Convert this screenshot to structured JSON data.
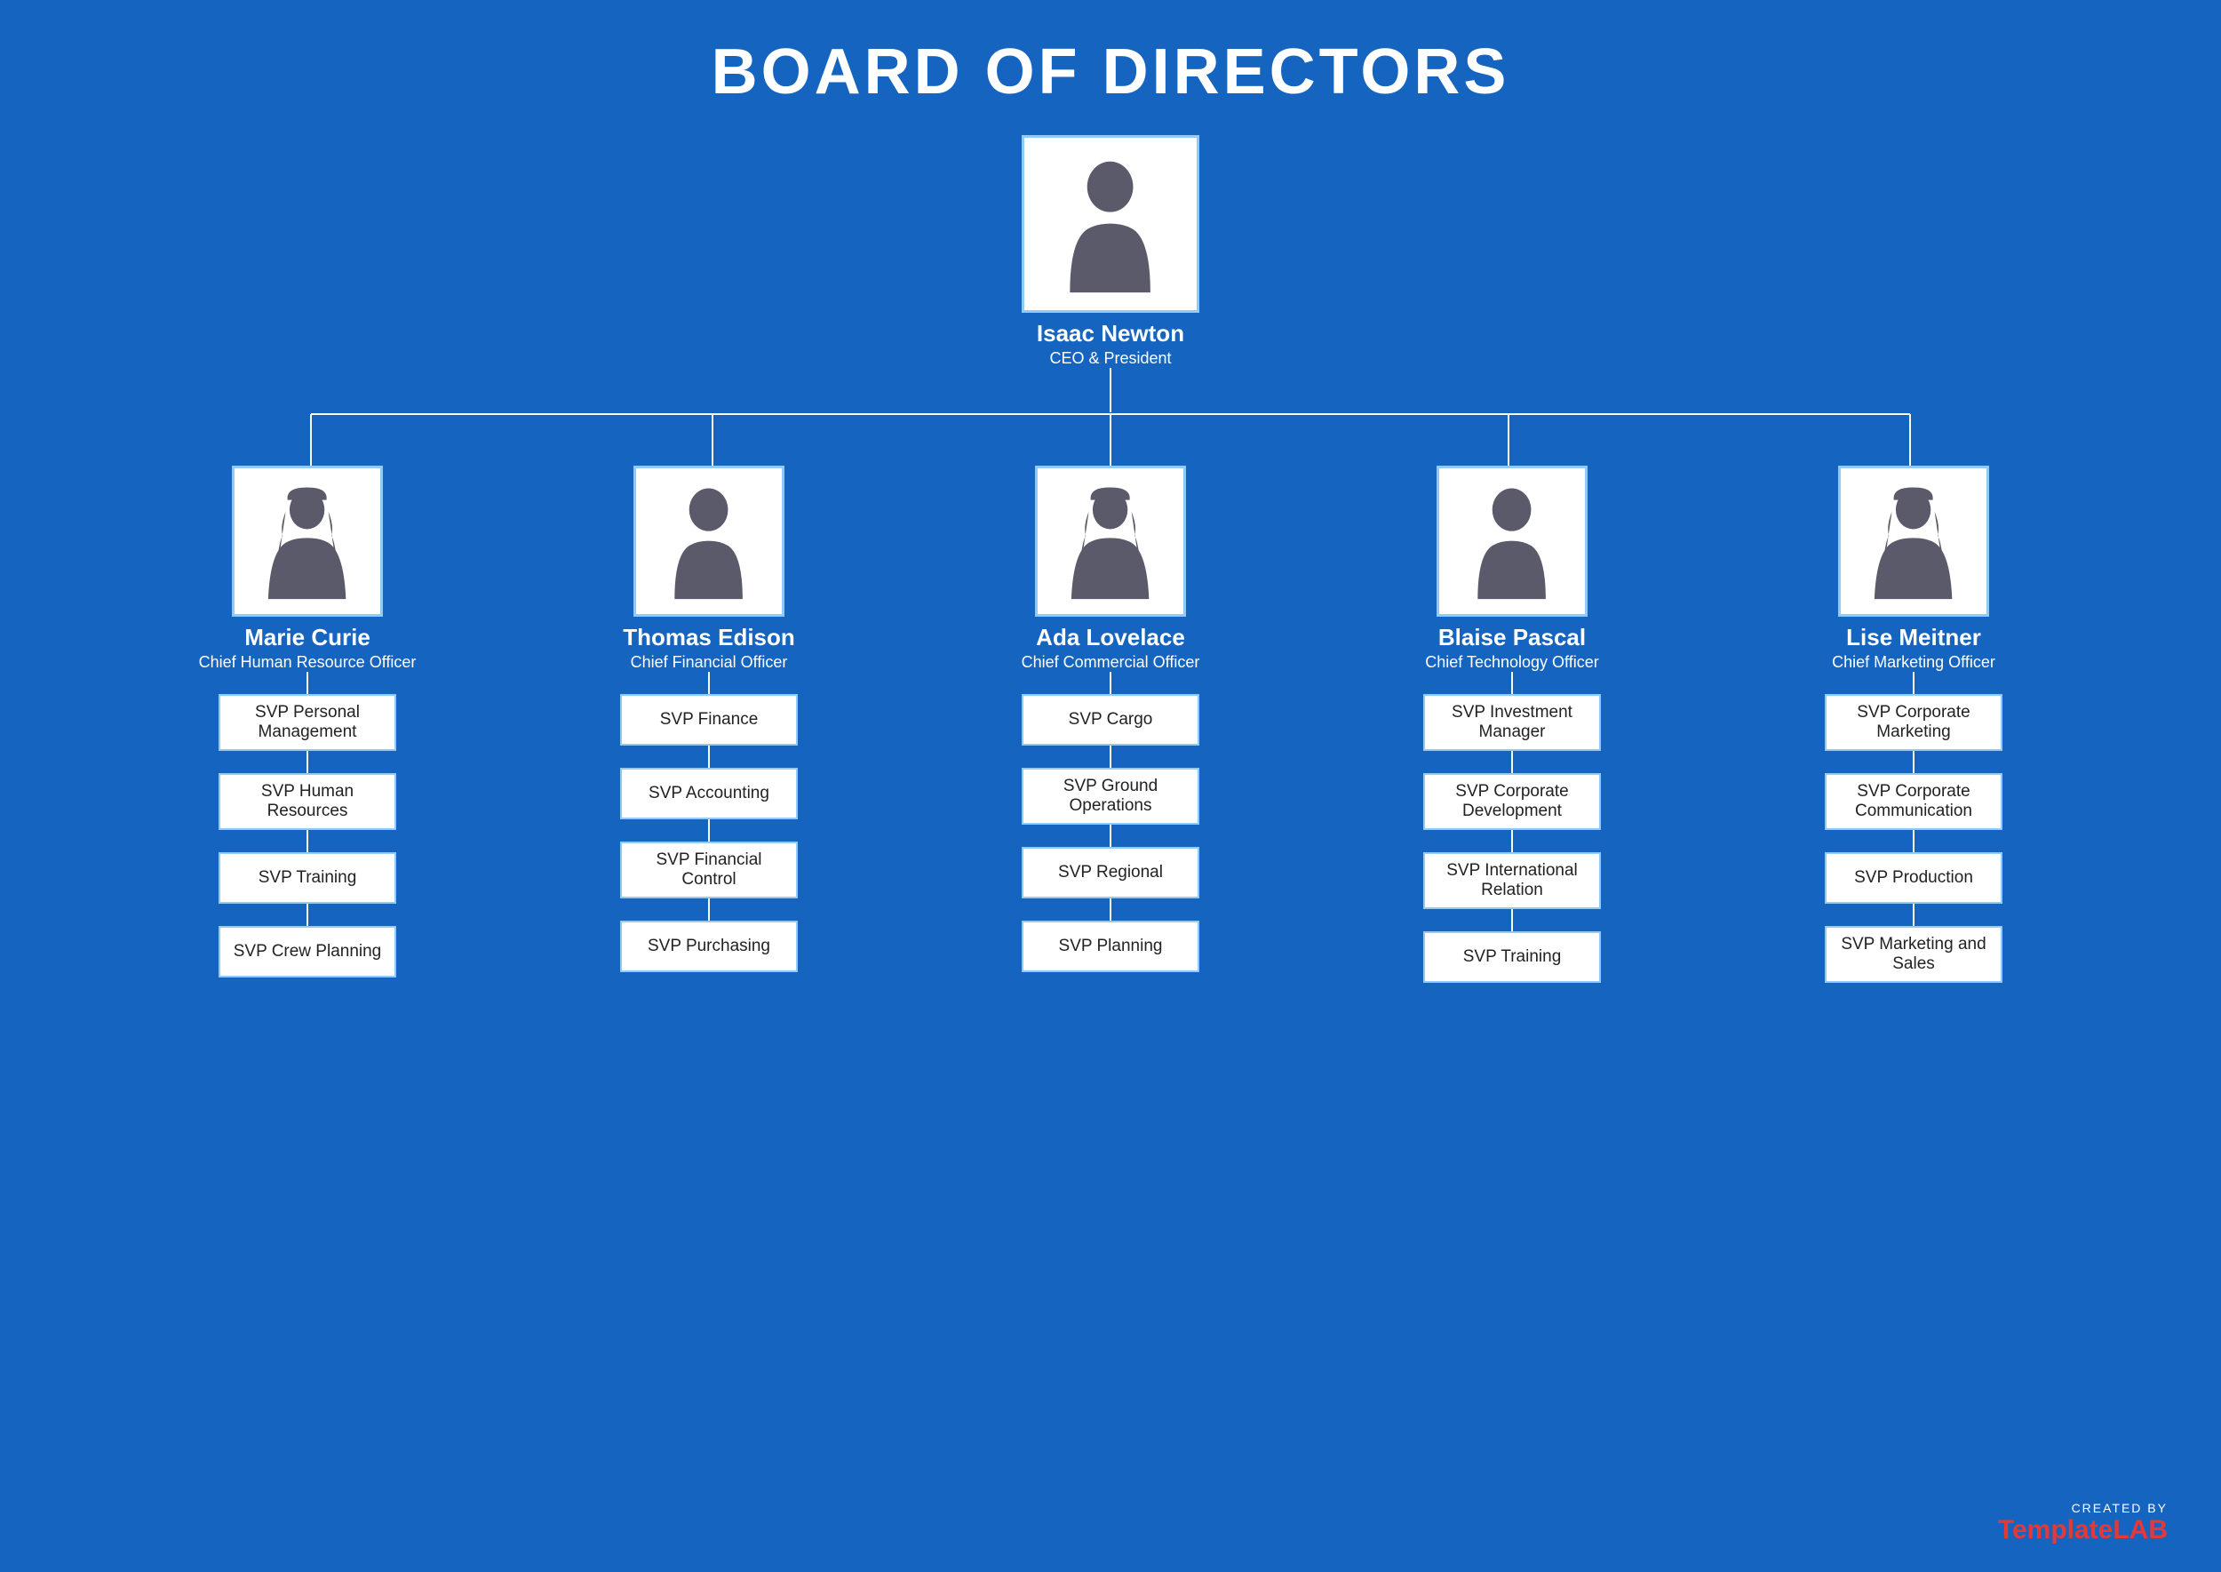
{
  "page": {
    "title": "BOARD OF DIRECTORS",
    "background_color": "#1565C0"
  },
  "ceo": {
    "name": "Isaac Newton",
    "role": "CEO & President",
    "gender": "male"
  },
  "level2": [
    {
      "name": "Marie Curie",
      "role": "Chief Human Resource Officer",
      "gender": "female",
      "svps": [
        "SVP Personal Management",
        "SVP Human Resources",
        "SVP Training",
        "SVP Crew Planning"
      ]
    },
    {
      "name": "Thomas Edison",
      "role": "Chief Financial Officer",
      "gender": "male",
      "svps": [
        "SVP Finance",
        "SVP Accounting",
        "SVP Financial Control",
        "SVP Purchasing"
      ]
    },
    {
      "name": "Ada Lovelace",
      "role": "Chief Commercial Officer",
      "gender": "female",
      "svps": [
        "SVP Cargo",
        "SVP Ground Operations",
        "SVP Regional",
        "SVP Planning"
      ]
    },
    {
      "name": "Blaise Pascal",
      "role": "Chief Technology Officer",
      "gender": "male",
      "svps": [
        "SVP Investment Manager",
        "SVP Corporate Development",
        "SVP International Relation",
        "SVP Training"
      ]
    },
    {
      "name": "Lise Meitner",
      "role": "Chief Marketing Officer",
      "gender": "female",
      "svps": [
        "SVP Corporate Marketing",
        "SVP Corporate Communication",
        "SVP Production",
        "SVP Marketing and Sales"
      ]
    }
  ],
  "watermark": {
    "created_by": "CREATED BY",
    "brand_normal": "Template",
    "brand_accent": "LAB"
  }
}
